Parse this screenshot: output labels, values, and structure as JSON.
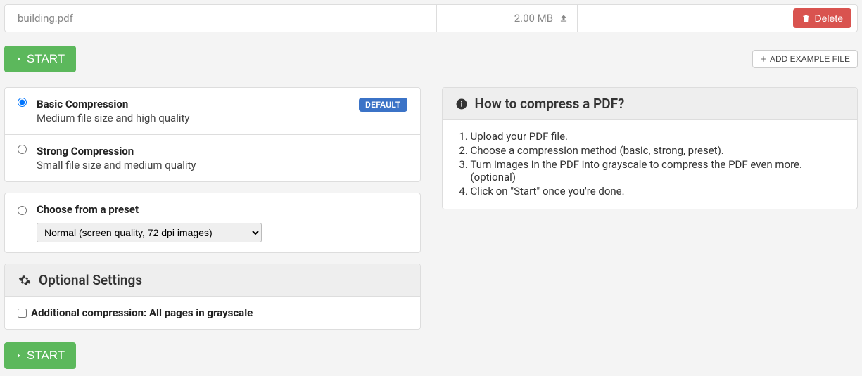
{
  "file": {
    "name": "building.pdf",
    "size": "2.00 MB"
  },
  "buttons": {
    "delete": "Delete",
    "start": "START",
    "add_example": "ADD EXAMPLE FILE"
  },
  "compression": {
    "basic": {
      "title": "Basic Compression",
      "subtitle": "Medium file size and high quality",
      "badge": "DEFAULT"
    },
    "strong": {
      "title": "Strong Compression",
      "subtitle": "Small file size and medium quality"
    },
    "preset": {
      "title": "Choose from a preset",
      "selected": "Normal (screen quality, 72 dpi images)"
    }
  },
  "optional": {
    "header": "Optional Settings",
    "grayscale_label": "Additional compression: All pages in grayscale"
  },
  "help": {
    "header": "How to compress a PDF?",
    "steps": [
      "Upload your PDF file.",
      "Choose a compression method (basic, strong, preset).",
      "Turn images in the PDF into grayscale to compress the PDF even more. (optional)",
      "Click on \"Start\" once you're done."
    ]
  }
}
